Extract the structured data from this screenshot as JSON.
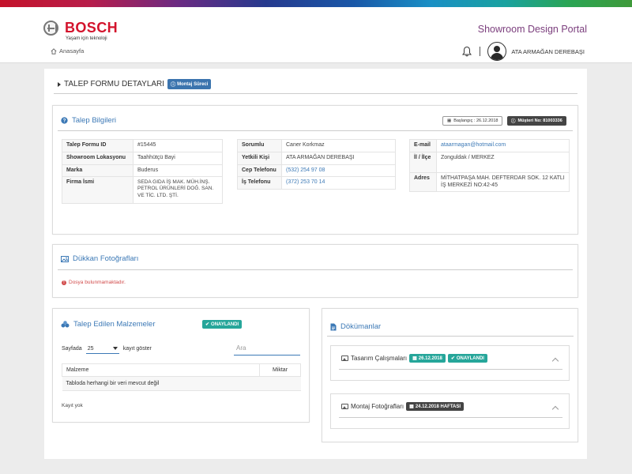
{
  "header": {
    "brand": "BOSCH",
    "tagline": "Yaşam için teknoloji",
    "portal_title": "Showroom Design Portal",
    "breadcrumb": "Anasayfa",
    "user_name": "ATA ARMAĞAN DEREBAŞI"
  },
  "page": {
    "title": "TALEP FORMU DETAYLARI",
    "badge": "Montaj Süreci"
  },
  "talep": {
    "title": "Talep Bilgileri",
    "start_label": "Başlangıç : 26.12.2018",
    "customer_label": "Müşteri No: 81003336",
    "col1": [
      {
        "k": "Talep Formu ID",
        "v": "#15445"
      },
      {
        "k": "Showroom Lokasyonu",
        "v": "Taahhütçü Bayi"
      },
      {
        "k": "Marka",
        "v": "Buderus"
      },
      {
        "k": "Firma İsmi",
        "v": "SEDA GIDA İŞ MAK. MÜH.İNŞ. PETROL ÜRÜNLERİ DOĞ. SAN. VE TİC. LTD. ŞTİ."
      }
    ],
    "col2": [
      {
        "k": "Sorumlu",
        "v": "Caner Korkmaz"
      },
      {
        "k": "Yetkili Kişi",
        "v": "ATA ARMAĞAN DEREBAŞI"
      },
      {
        "k": "Cep Telefonu",
        "v": "(532) 254 97 08"
      },
      {
        "k": "İş Telefonu",
        "v": "(372) 253 70 14"
      }
    ],
    "col3": [
      {
        "k": "E-mail",
        "v": "ataarmagan@hotmail.com"
      },
      {
        "k": "İl / İlçe",
        "v": "Zonguldak / MERKEZ"
      },
      {
        "k": "Adres",
        "v": "MİTHATPAŞA MAH. DEFTERDAR SOK. 12 KATLI İŞ MERKEZİ NO:42-45"
      }
    ]
  },
  "dukkan": {
    "title": "Dükkan Fotoğrafları",
    "error": "Dosya bulunmamaktadır."
  },
  "malzeme": {
    "title": "Talep Edilen Malzemeler",
    "badge": "ONAYLANDI",
    "per_page_label": "Sayfada",
    "per_page_value": "25",
    "show_label": "kayıt göster",
    "search_placeholder": "Ara",
    "col_malzeme": "Malzeme",
    "col_miktar": "Miktar",
    "empty_text": "Tabloda herhangi bir veri mevcut değil",
    "footer": "Kayıt yok"
  },
  "dokumanlar": {
    "title": "Dökümanlar",
    "tasarim_label": "Tasarım Çalışmaları",
    "tasarim_date": "26.12.2018",
    "tasarim_status": "ONAYLANDI",
    "montaj_label": "Montaj Fotoğrafları",
    "montaj_date": "24.12.2018 HAFTASI"
  },
  "colors": {
    "brand_red": "#d3132c",
    "portal_purple": "#7b3e7d",
    "link_blue": "#3c79b6",
    "approved_green": "#26a69a",
    "error_red": "#d14b4b"
  }
}
